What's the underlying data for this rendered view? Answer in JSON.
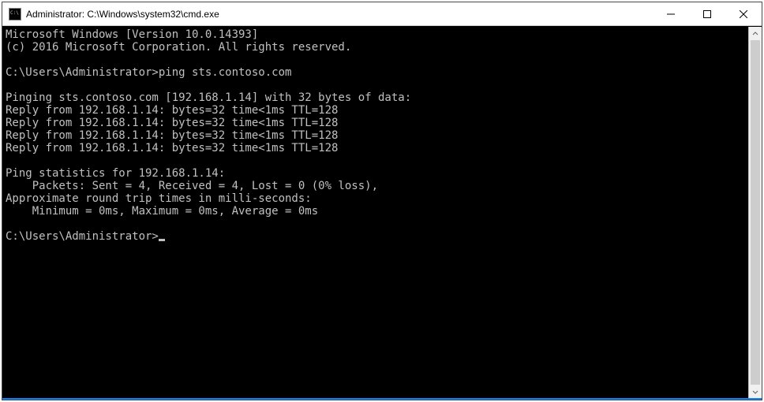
{
  "titlebar": {
    "icon": "cmd-icon",
    "title": "Administrator: C:\\Windows\\system32\\cmd.exe"
  },
  "window_controls": {
    "minimize": "minimize",
    "maximize": "maximize",
    "close": "close"
  },
  "terminal": {
    "lines": [
      "Microsoft Windows [Version 10.0.14393]",
      "(c) 2016 Microsoft Corporation. All rights reserved.",
      "",
      "C:\\Users\\Administrator>ping sts.contoso.com",
      "",
      "Pinging sts.contoso.com [192.168.1.14] with 32 bytes of data:",
      "Reply from 192.168.1.14: bytes=32 time<1ms TTL=128",
      "Reply from 192.168.1.14: bytes=32 time<1ms TTL=128",
      "Reply from 192.168.1.14: bytes=32 time<1ms TTL=128",
      "Reply from 192.168.1.14: bytes=32 time<1ms TTL=128",
      "",
      "Ping statistics for 192.168.1.14:",
      "    Packets: Sent = 4, Received = 4, Lost = 0 (0% loss),",
      "Approximate round trip times in milli-seconds:",
      "    Minimum = 0ms, Maximum = 0ms, Average = 0ms",
      ""
    ],
    "current_prompt": "C:\\Users\\Administrator>"
  }
}
